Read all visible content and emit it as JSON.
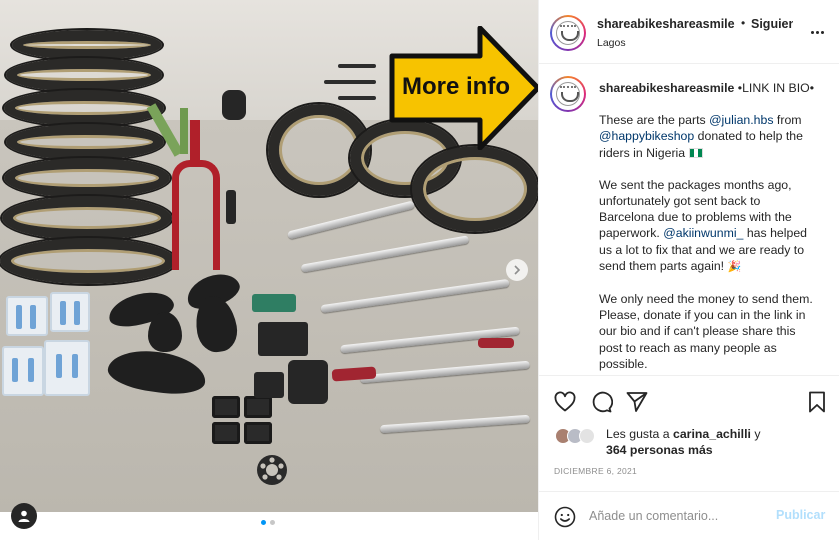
{
  "post": {
    "username": "shareabikeshareasmile",
    "separator": "•",
    "follow_label": "Siguiendo",
    "location": "Lagos",
    "more_label": "More info"
  },
  "caption": {
    "username": "shareabikeshareasmile",
    "first_line": " •LINK IN BIO•",
    "p1_a": "These are the parts ",
    "p1_mention1": "@julian.hbs",
    "p1_b": " from ",
    "p1_mention2": "@happybikeshop",
    "p1_c": " donated to help the riders in Nigeria ",
    "p2_a": "We sent the packages months ago, unfortunately got sent back to Barcelona due to problems with the paperwork. ",
    "p2_mention": "@akiinwunmi_",
    "p2_b": " has helped us a lot to fix that and we are ready to send them parts again! ",
    "p3": "We only need the money to send them. Please, donate if you can in the link in our bio and if can't please share this post to reach as many people as possible."
  },
  "likes": {
    "prefix": "Les gusta a ",
    "user": "carina_achilli",
    "conj": " y",
    "count": "364 personas más"
  },
  "date": "DICIEMBRE 6, 2021",
  "composer": {
    "placeholder": "Añade un comentario...",
    "publish_label": "Publicar"
  },
  "carousel": {
    "slides": 2,
    "current": 1
  },
  "icons": {
    "like": "heart-icon",
    "comment": "comment-icon",
    "share": "paper-plane-icon",
    "save": "bookmark-icon",
    "emoji": "smiley-icon",
    "next": "chevron-right-icon",
    "tag": "user-tag-icon"
  },
  "colors": {
    "link": "#00376b",
    "publish_disabled": "#b2dffc",
    "muted": "#8e8e8e",
    "carousel_active": "#0095f6",
    "overlay_yellow": "#f7c300"
  }
}
